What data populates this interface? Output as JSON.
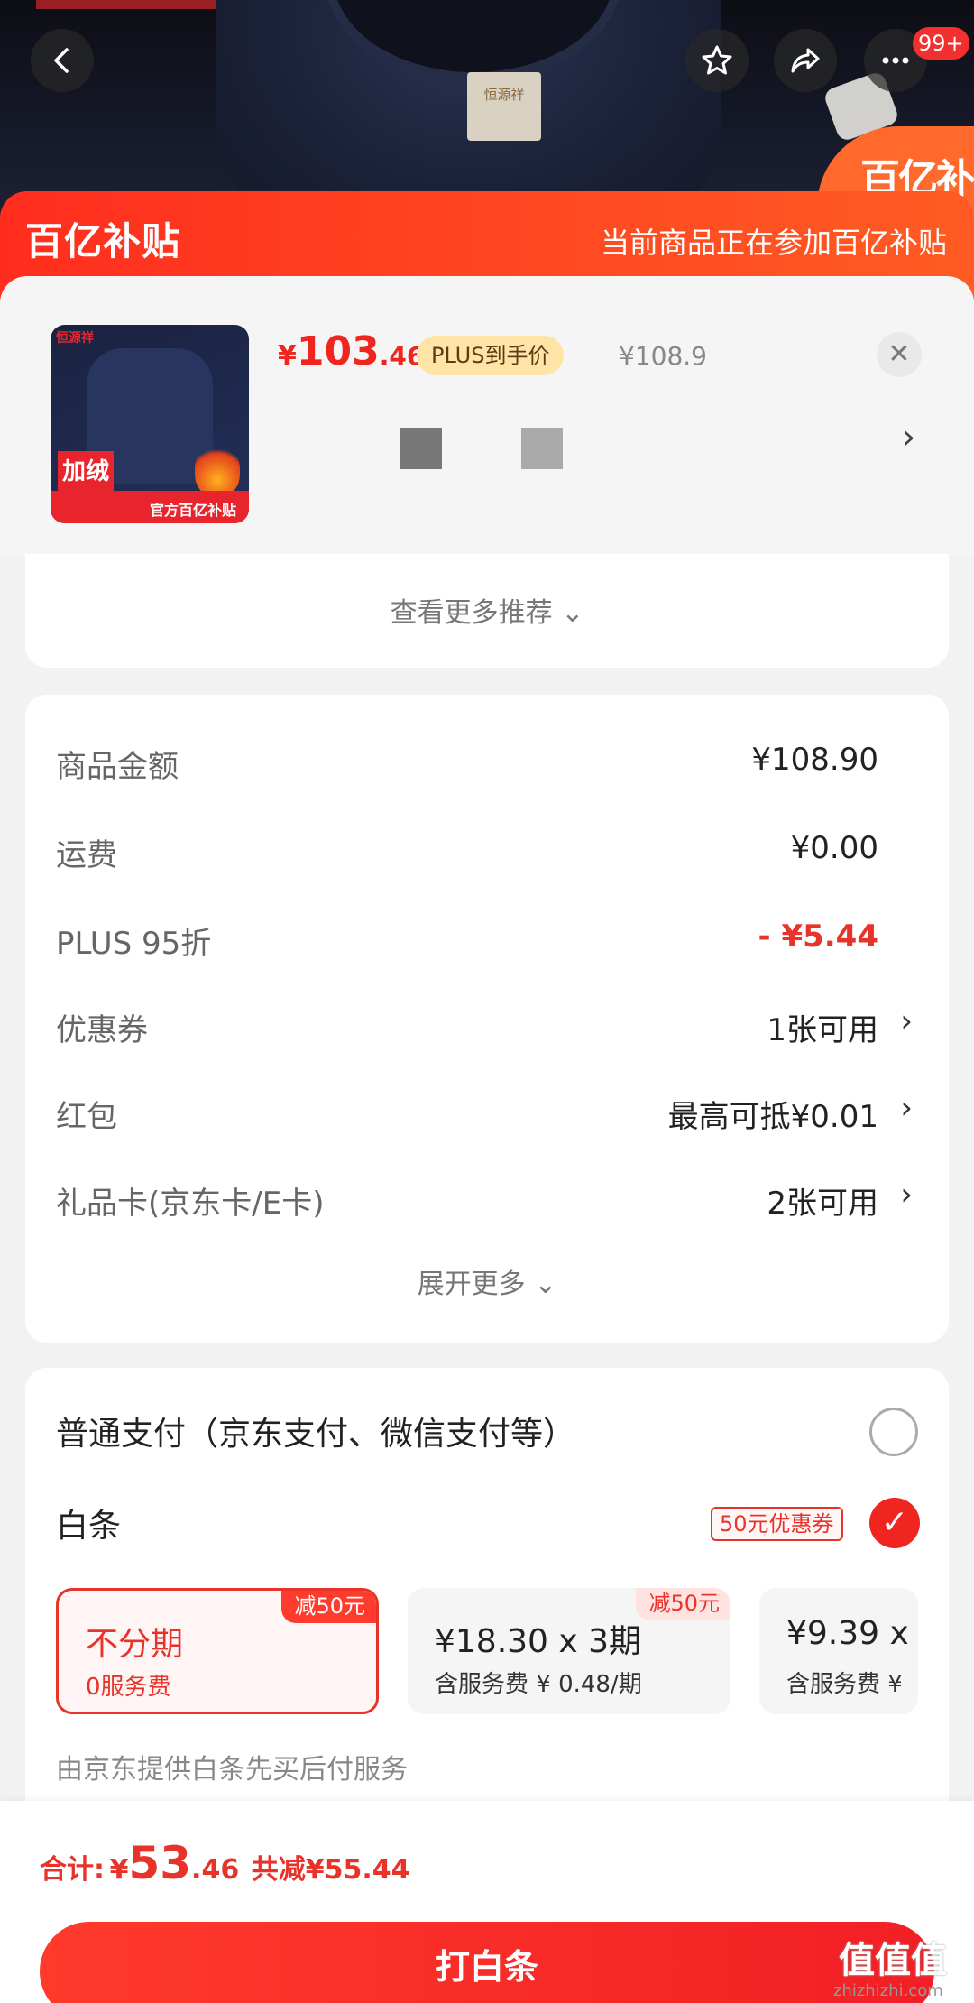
{
  "header": {
    "notification_count": "99+",
    "tag_text": "恒源祥"
  },
  "banner": {
    "logo": "百亿补贴",
    "message": "当前商品正在参加百亿补贴"
  },
  "product": {
    "thumb_brand": "恒源祥",
    "thumb_badge": "加绒",
    "thumb_strip": "官方百亿补贴",
    "price_currency": "¥",
    "price_int": "103",
    "price_dec": ".46",
    "plus_label": "PLUS到手价",
    "original_price": "¥108.9",
    "close_icon": "close-icon",
    "arrow": "›"
  },
  "recommend": {
    "label": "查看更多推荐 ⌄"
  },
  "fees": {
    "rows": [
      {
        "label": "商品金额",
        "value": "¥108.90"
      },
      {
        "label": "运费",
        "value": "¥0.00"
      },
      {
        "label": "PLUS 95折",
        "value": "- ¥5.44"
      },
      {
        "label": "优惠券",
        "value": "1张可用"
      },
      {
        "label": "红包",
        "value": "最高可抵¥0.01"
      },
      {
        "label": "礼品卡(京东卡/E卡)",
        "value": "2张可用"
      }
    ],
    "expand_label": "展开更多 ⌄",
    "discount_color": "#e8332a"
  },
  "payment": {
    "normal_label": "普通支付（京东支付、微信支付等）",
    "baitiao_label": "白条",
    "coupon_badge": "50元优惠券",
    "plans": [
      {
        "title": "不分期",
        "sub": "0服务费",
        "tag": "减50元"
      },
      {
        "title": "¥18.30 x 3期",
        "sub": "含服务费 ¥ 0.48/期",
        "tag": "减50元"
      },
      {
        "title": "¥9.39 x",
        "sub": "含服务费 ¥",
        "tag": ""
      }
    ],
    "note": "由京东提供白条先买后付服务"
  },
  "bottom": {
    "total_label": "合计:",
    "currency": "¥",
    "total_int": "53",
    "total_dec": ".46",
    "saved": "共减¥55.44",
    "pay_button": "打白条",
    "accent_color": "#f0251f"
  },
  "watermark": {
    "main": "值值值",
    "site": "zhizhizhi.com"
  }
}
